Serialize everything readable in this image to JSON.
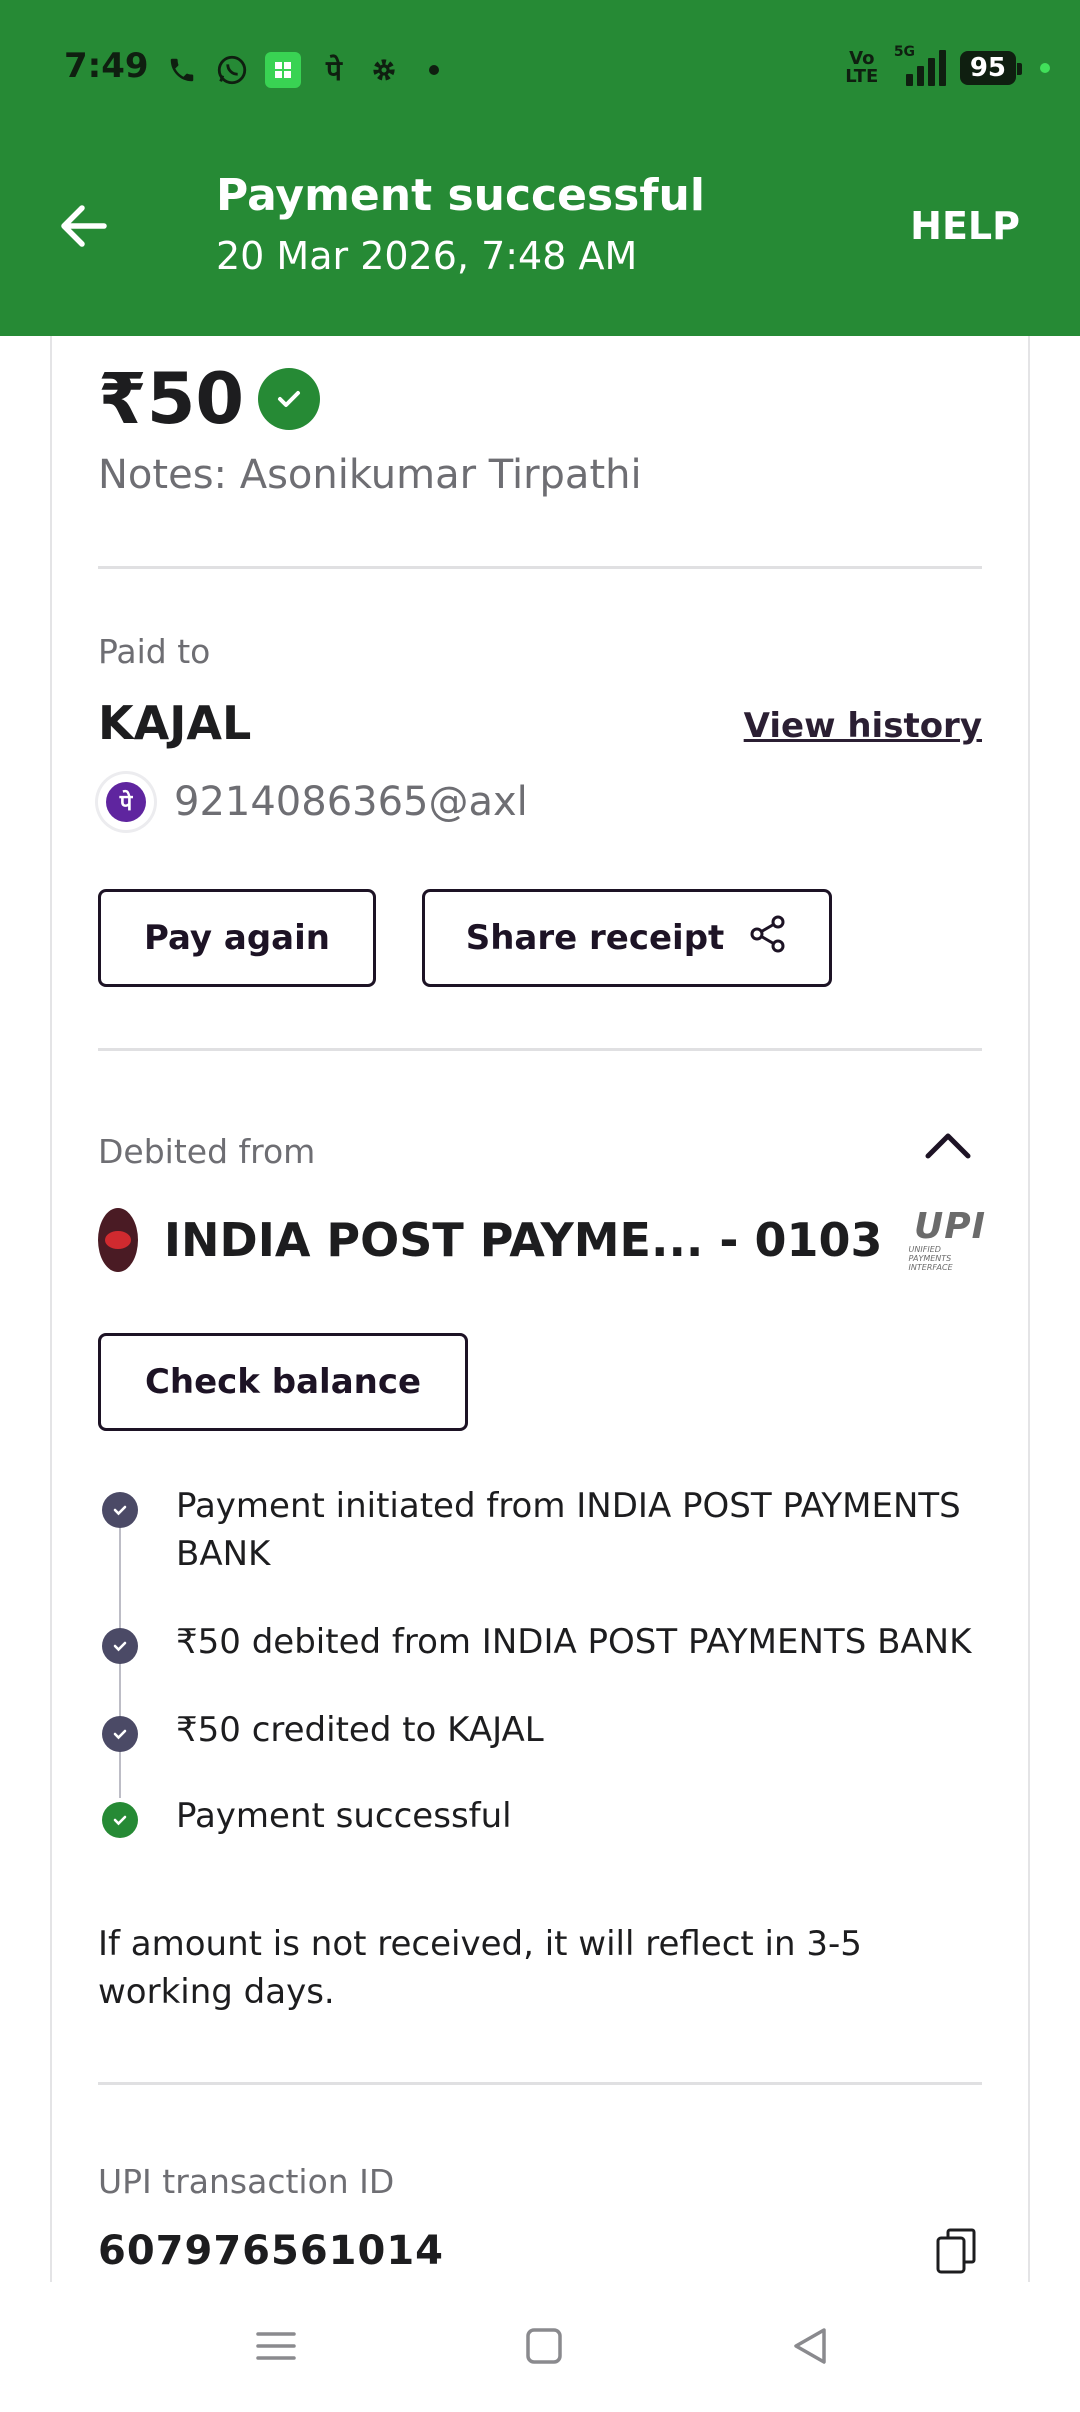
{
  "status_bar": {
    "time": "7:49",
    "network": "5G",
    "volte": "Vo LTE",
    "battery": "95"
  },
  "header": {
    "title": "Payment successful",
    "datetime": "20 Mar 2026, 7:48 AM",
    "help_label": "HELP",
    "bg_color": "#268a35"
  },
  "summary": {
    "amount": "₹50",
    "notes": "Notes: Asonikumar Tirpathi"
  },
  "paid_to": {
    "label": "Paid to",
    "name": "KAJAL",
    "view_history": "View history",
    "upi_id": "9214086365@axl",
    "pay_again": "Pay again",
    "share_receipt": "Share receipt"
  },
  "debited_from": {
    "label": "Debited from",
    "bank": "INDIA POST PAYME... - 0103",
    "upi_logo_text": "UPI",
    "upi_logo_sub": "UNIFIED PAYMENTS INTERFACE",
    "check_balance": "Check balance"
  },
  "timeline": [
    {
      "text": "Payment initiated from INDIA POST PAYMENTS BANK",
      "status": "done"
    },
    {
      "text": "₹50 debited from INDIA POST PAYMENTS BANK",
      "status": "done"
    },
    {
      "text": "₹50 credited to KAJAL",
      "status": "done"
    },
    {
      "text": "Payment successful",
      "status": "success"
    }
  ],
  "note": "If amount is not received, it will reflect in 3-5 working days.",
  "transaction": {
    "label": "UPI transaction ID",
    "id": "607976561014"
  },
  "nav": {
    "icons": [
      "menu-icon",
      "home-icon",
      "back-icon"
    ]
  }
}
